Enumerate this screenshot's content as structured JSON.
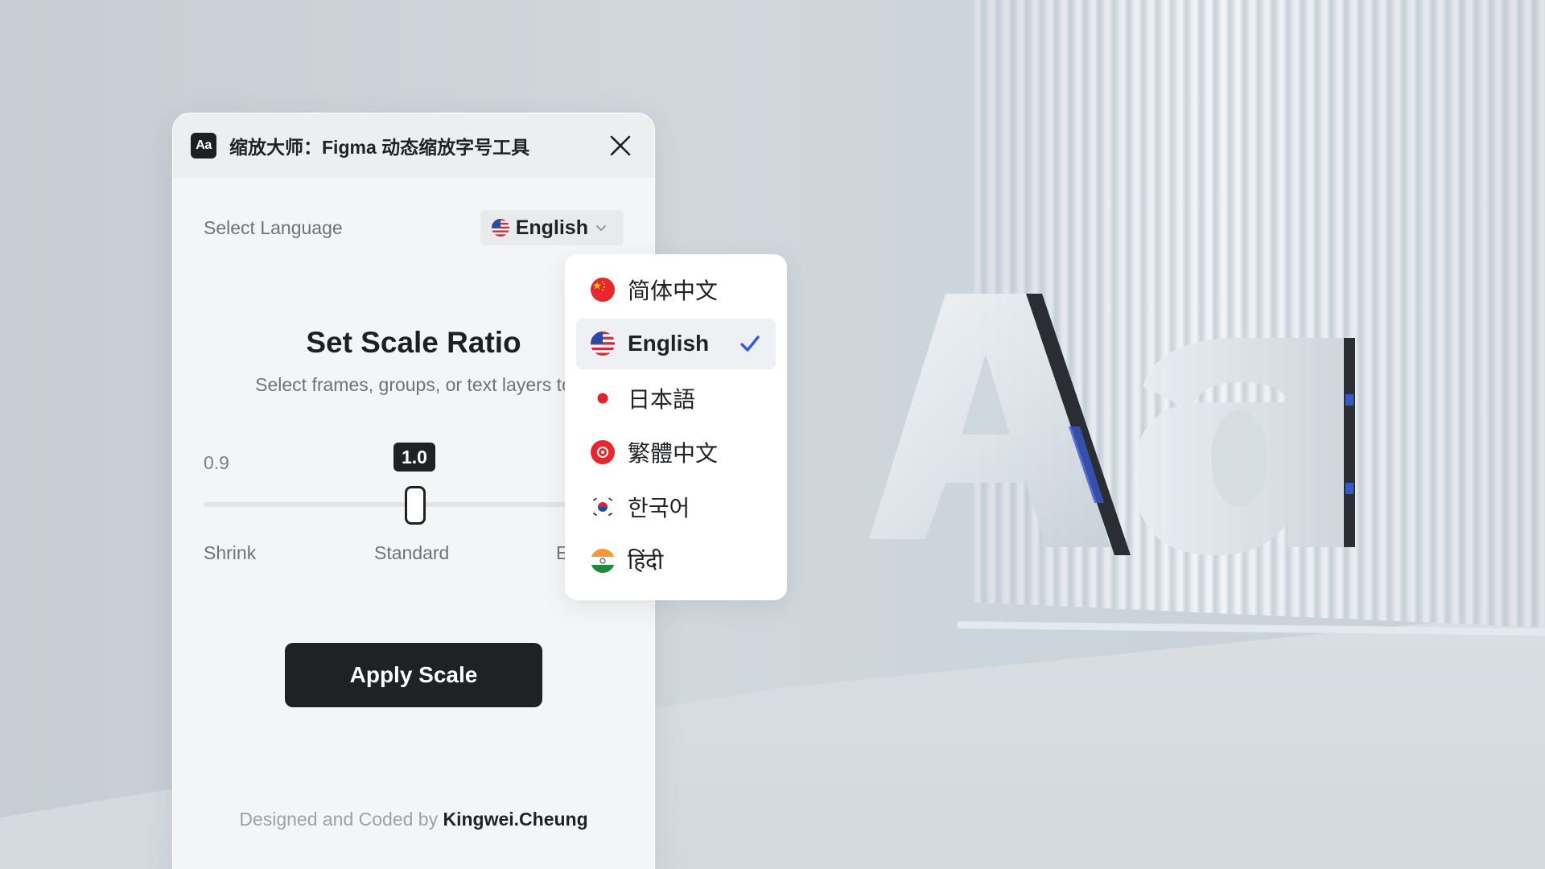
{
  "window": {
    "title": "缩放大师：Figma 动态缩放字号工具",
    "app_icon_text": "Aa",
    "close_icon": "close-icon"
  },
  "language": {
    "label": "Select Language",
    "selected": "English",
    "selected_flag": "us-flag-icon"
  },
  "main": {
    "heading": "Set Scale Ratio",
    "subtext": "Select frames, groups, or text layers to"
  },
  "slider": {
    "min_value_text": "0.9",
    "current_value_text": "1.0",
    "label_shrink": "Shrink",
    "label_standard": "Standard",
    "label_enlarge": "E"
  },
  "apply_button": {
    "label": "Apply Scale"
  },
  "footer": {
    "prefix": "Designed and Coded by",
    "author": "Kingwei.Cheung"
  },
  "dropdown": {
    "items": [
      {
        "label": "简体中文",
        "flag": "cn-flag-icon",
        "selected": false
      },
      {
        "label": "English",
        "flag": "us-flag-icon",
        "selected": true
      },
      {
        "label": "日本語",
        "flag": "jp-flag-icon",
        "selected": false
      },
      {
        "label": "繁體中文",
        "flag": "hk-flag-icon",
        "selected": false
      },
      {
        "label": "한국어",
        "flag": "kr-flag-icon",
        "selected": false
      },
      {
        "label": "हिंदी",
        "flag": "in-flag-icon",
        "selected": false
      }
    ],
    "check_icon": "check-icon",
    "check_color": "#2f5be6"
  },
  "colors": {
    "primary_dark": "#1f2123",
    "panel_bg": "#f4f5f6",
    "titlebar_bg": "#eceef0"
  }
}
